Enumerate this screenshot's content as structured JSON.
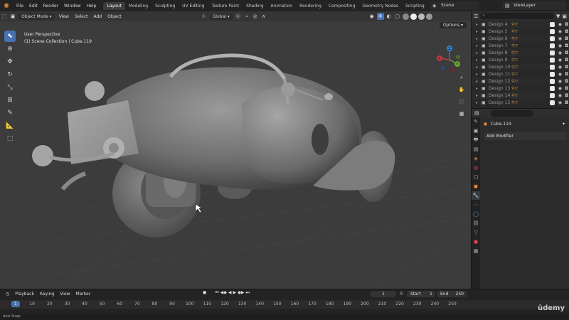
{
  "topbar": {
    "menus": [
      "File",
      "Edit",
      "Render",
      "Window",
      "Help"
    ],
    "workspaces": [
      "Layout",
      "Modeling",
      "Sculpting",
      "UV Editing",
      "Texture Paint",
      "Shading",
      "Animation",
      "Rendering",
      "Compositing",
      "Geometry Nodes",
      "Scripting"
    ],
    "active_workspace": "Layout",
    "scene": "Scene",
    "view_layer": "ViewLayer"
  },
  "viewport": {
    "mode": "Object Mode",
    "menus": [
      "View",
      "Select",
      "Add",
      "Object"
    ],
    "transform_orientation": "Global",
    "options_label": "Options",
    "info_line1": "User Perspective",
    "info_line2": "(1) Scene Collection | Cube.119",
    "gizmo_axes": {
      "x": "X",
      "y": "Y",
      "z": "Z"
    }
  },
  "outliner": {
    "rows": [
      {
        "name": "Design 4"
      },
      {
        "name": "Design 5"
      },
      {
        "name": "Design 6"
      },
      {
        "name": "Design 7"
      },
      {
        "name": "Design 8"
      },
      {
        "name": "Design 9"
      },
      {
        "name": "Design 10"
      },
      {
        "name": "Design 11"
      },
      {
        "name": "Design 12"
      },
      {
        "name": "Design 13"
      },
      {
        "name": "Design 14"
      },
      {
        "name": "Design 15"
      }
    ]
  },
  "properties": {
    "object_name": "Cube.119",
    "add_modifier": "Add Modifier"
  },
  "timeline": {
    "menus": [
      "Playback",
      "Keying",
      "View",
      "Marker"
    ],
    "current_frame": "1",
    "start_label": "Start",
    "start_value": "1",
    "end_label": "End",
    "end_value": "250",
    "ruler_ticks": [
      "1",
      "10",
      "20",
      "30",
      "40",
      "50",
      "60",
      "70",
      "80",
      "90",
      "100",
      "110",
      "120",
      "130",
      "140",
      "150",
      "160",
      "170",
      "180",
      "190",
      "200",
      "210",
      "220",
      "230",
      "240",
      "250"
    ]
  },
  "statusbar": {
    "text": "Axis Snap"
  },
  "watermark": "ūdemy",
  "colors": {
    "accent": "#4772b3",
    "orange": "#e8893a",
    "viewport_bg": "#3c3c3c"
  }
}
